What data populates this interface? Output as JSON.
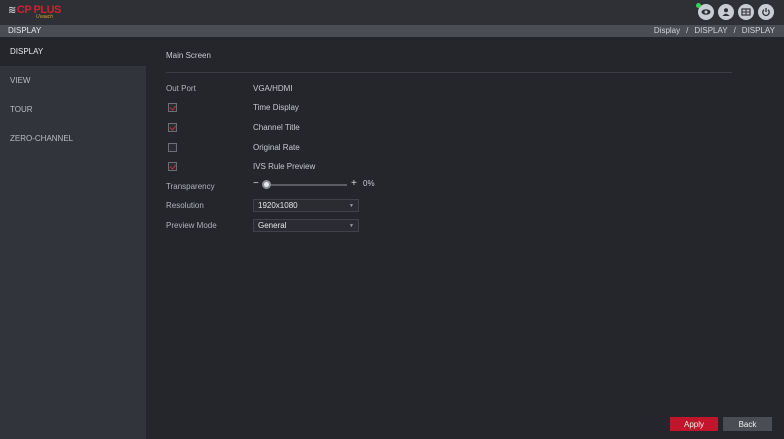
{
  "header": {
    "logo_mark": "≋",
    "brand": "CP PLUS",
    "brand_sub": "Uvaach",
    "icons": [
      "eye-icon",
      "user-icon",
      "grid-icon",
      "power-icon"
    ]
  },
  "titlebar": {
    "title": "DISPLAY",
    "breadcrumb": [
      "Display",
      "DISPLAY",
      "DISPLAY"
    ],
    "separator": "/"
  },
  "sidebar": {
    "items": [
      {
        "label": "DISPLAY",
        "active": true
      },
      {
        "label": "VIEW",
        "active": false
      },
      {
        "label": "TOUR",
        "active": false
      },
      {
        "label": "ZERO-CHANNEL",
        "active": false
      }
    ]
  },
  "main": {
    "section_title": "Main Screen",
    "out_port": {
      "label": "Out Port",
      "value": "VGA/HDMI"
    },
    "options": [
      {
        "label": "Time Display",
        "checked": true
      },
      {
        "label": "Channel Title",
        "checked": true
      },
      {
        "label": "Original Rate",
        "checked": false
      },
      {
        "label": "IVS Rule Preview",
        "checked": true
      }
    ],
    "transparency": {
      "label": "Transparency",
      "minus": "−",
      "plus": "+",
      "value_text": "0%",
      "value": 0
    },
    "resolution": {
      "label": "Resolution",
      "value": "1920x1080"
    },
    "preview_mode": {
      "label": "Preview Mode",
      "value": "General"
    },
    "caret": "▼"
  },
  "buttons": {
    "apply": "Apply",
    "back": "Back"
  },
  "colors": {
    "accent": "#c0152a",
    "check": "#c0303a",
    "status_dot": "#3ccf4e"
  }
}
